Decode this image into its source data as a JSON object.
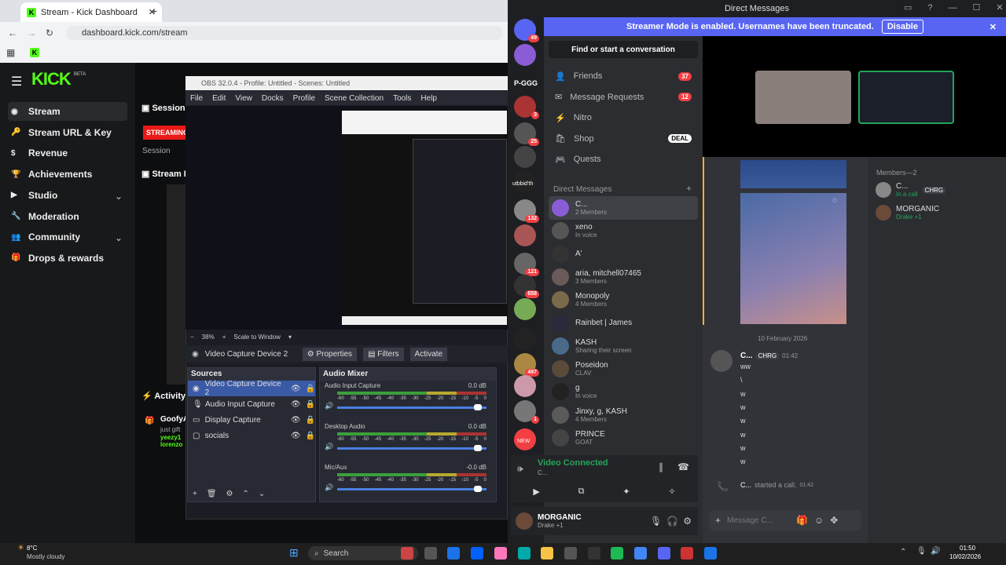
{
  "browser": {
    "tab_title": "Stream - Kick Dashboard",
    "url": "dashboard.kick.com/stream"
  },
  "kick": {
    "logo": "KICK",
    "beta": "BETA",
    "nav": [
      {
        "label": "Stream",
        "icon": "record-icon"
      },
      {
        "label": "Stream URL & Key",
        "icon": "key-icon"
      },
      {
        "label": "Revenue",
        "icon": "dollar-icon"
      },
      {
        "label": "Achievements",
        "icon": "trophy-icon"
      },
      {
        "label": "Studio",
        "icon": "video-icon"
      },
      {
        "label": "Moderation",
        "icon": "wrench-icon"
      },
      {
        "label": "Community",
        "icon": "users-icon"
      },
      {
        "label": "Drops & rewards",
        "icon": "gift-icon"
      }
    ],
    "session_label": "Session In",
    "streaming": "STREAMING",
    "session": "Session",
    "stream_preview": "Stream Pr",
    "activity": "Activity F",
    "activity_user": "GoofyA",
    "activity_text": "just gift",
    "user1": "yeezy1",
    "user2": "lorenzo"
  },
  "obs": {
    "title": "OBS 32.0.4 - Profile: Untitled - Scenes: Untitled",
    "menu": [
      "File",
      "Edit",
      "View",
      "Docks",
      "Profile",
      "Scene Collection",
      "Tools",
      "Help"
    ],
    "zoom": "38%",
    "scale": "Scale to Window",
    "selected_source": "Video Capture Device 2",
    "properties": "Properties",
    "filters": "Filters",
    "activate": "Activate",
    "sources_title": "Sources",
    "sources": [
      "Video Capture Device 2",
      "Audio Input Capture",
      "Display Capture",
      "socials"
    ],
    "mixer_title": "Audio Mixer",
    "mixer": [
      {
        "name": "Audio Input Capture",
        "db": "0.0 dB",
        "level": 0.62
      },
      {
        "name": "Desktop Audio",
        "db": "0.0 dB",
        "level": 0.6
      },
      {
        "name": "Mic/Aux",
        "db": "-0.0 dB",
        "level": 0.6
      }
    ],
    "ticks": [
      "-60",
      "-55",
      "-50",
      "-45",
      "-40",
      "-35",
      "-30",
      "-25",
      "-20",
      "-15",
      "-10",
      "-5",
      "0"
    ]
  },
  "discord": {
    "window_title": "Direct Messages",
    "streamer_text": "Streamer Mode is enabled. Usernames have been truncated.",
    "disable": "Disable",
    "search": "Find or start a conversation",
    "nav": [
      {
        "label": "Friends",
        "count": "37"
      },
      {
        "label": "Message Requests",
        "count": "12"
      },
      {
        "label": "Nitro",
        "count": ""
      },
      {
        "label": "Shop",
        "count": "DEAL"
      },
      {
        "label": "Quests",
        "count": ""
      }
    ],
    "dm_header": "Direct Messages",
    "dms": [
      {
        "name": "C...",
        "sub": "2 Members"
      },
      {
        "name": "xeno",
        "sub": "In voice"
      },
      {
        "name": "A'",
        "sub": ""
      },
      {
        "name": "aria, mitchell07465",
        "sub": "3 Members"
      },
      {
        "name": "Monopoly",
        "sub": "4 Members"
      },
      {
        "name": "Rainbet | James",
        "sub": ""
      },
      {
        "name": "KASH",
        "sub": "Sharing their screen"
      },
      {
        "name": "Poseidon",
        "sub": "CLAV"
      },
      {
        "name": "g",
        "sub": "In voice"
      },
      {
        "name": "Jinxy, g, KASH",
        "sub": "4 Members"
      },
      {
        "name": "PRINCE",
        "sub": "GOAT"
      }
    ],
    "server_badges": [
      "49",
      "3",
      "25",
      "132",
      "121",
      "658",
      "497",
      "1"
    ],
    "server_labels": [
      "P-GGG",
      "utbbid'th",
      "NEW"
    ],
    "voice": {
      "status": "Video Connected",
      "sub": "C..."
    },
    "user": {
      "name": "MORGANIC",
      "status": "Drake +1"
    },
    "date": "10 February 2026",
    "msg_author": "C...",
    "msg_tag": "CHRG",
    "msg_time": "01:42",
    "msgs": [
      "ww",
      "\\",
      "w",
      "w",
      "w",
      "w",
      "w",
      "w"
    ],
    "call_text": "started a call.",
    "call_time": "01:42",
    "input_placeholder": "Message C...",
    "members_header": "Members—2",
    "members": [
      {
        "name": "C...",
        "tag": "CHRG",
        "sub": "In a call"
      },
      {
        "name": "MORGANIC",
        "tag": "",
        "sub": "Drake +1"
      }
    ]
  },
  "taskbar": {
    "temp": "8°C",
    "weather": "Mostly cloudy",
    "search": "Search",
    "time": "01:50",
    "date": "10/02/2026"
  }
}
